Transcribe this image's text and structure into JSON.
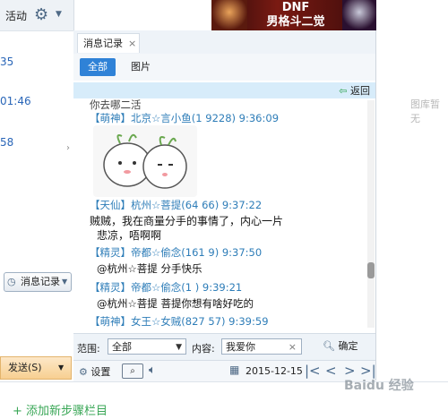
{
  "left": {
    "activity_label": "活动",
    "time_fragments": [
      "35",
      "01:46",
      "58"
    ],
    "history_button": "消息记录",
    "send_button": "发送(S)"
  },
  "ad": {
    "line1": "DNF",
    "line2": "男格斗二觉"
  },
  "right_hint": "图库暂无",
  "tabs": {
    "history_tab": "消息记录"
  },
  "subtabs": {
    "all": "全部",
    "pictures": "图片"
  },
  "back_label": "返回",
  "messages": [
    {
      "head": "你去哪二活",
      "body": ""
    },
    {
      "head": "【萌神】北京☆言小鱼(1       9228) 9:36:09",
      "body": ""
    },
    {
      "head": "【天仙】杭州☆菩提(64      66) 9:37:22",
      "body": "贼贼，我在商量分手的事情了，内心一片"
    },
    {
      "head": "",
      "body": "悲凉，唔啊啊"
    },
    {
      "head": "【精灵】帝都☆偷念(161      9) 9:37:50",
      "body": "@杭州☆菩提 分手快乐"
    },
    {
      "head": "【精灵】帝都☆偷念(1       ) 9:39:21",
      "body": "@杭州☆菩提 菩提你想有啥好吃的"
    },
    {
      "head": "【萌神】女王☆女贼(827      57) 9:39:59",
      "body": ""
    }
  ],
  "filter": {
    "range_label": "范围:",
    "range_value": "全部",
    "content_label": "内容:",
    "content_value": "我爱你",
    "confirm": "确定"
  },
  "toolbar": {
    "settings": "设置",
    "date": "2015-12-15"
  },
  "bottom": {
    "add_step": "+ 添加新步骤栏目"
  },
  "watermark": "Baidu 经验"
}
